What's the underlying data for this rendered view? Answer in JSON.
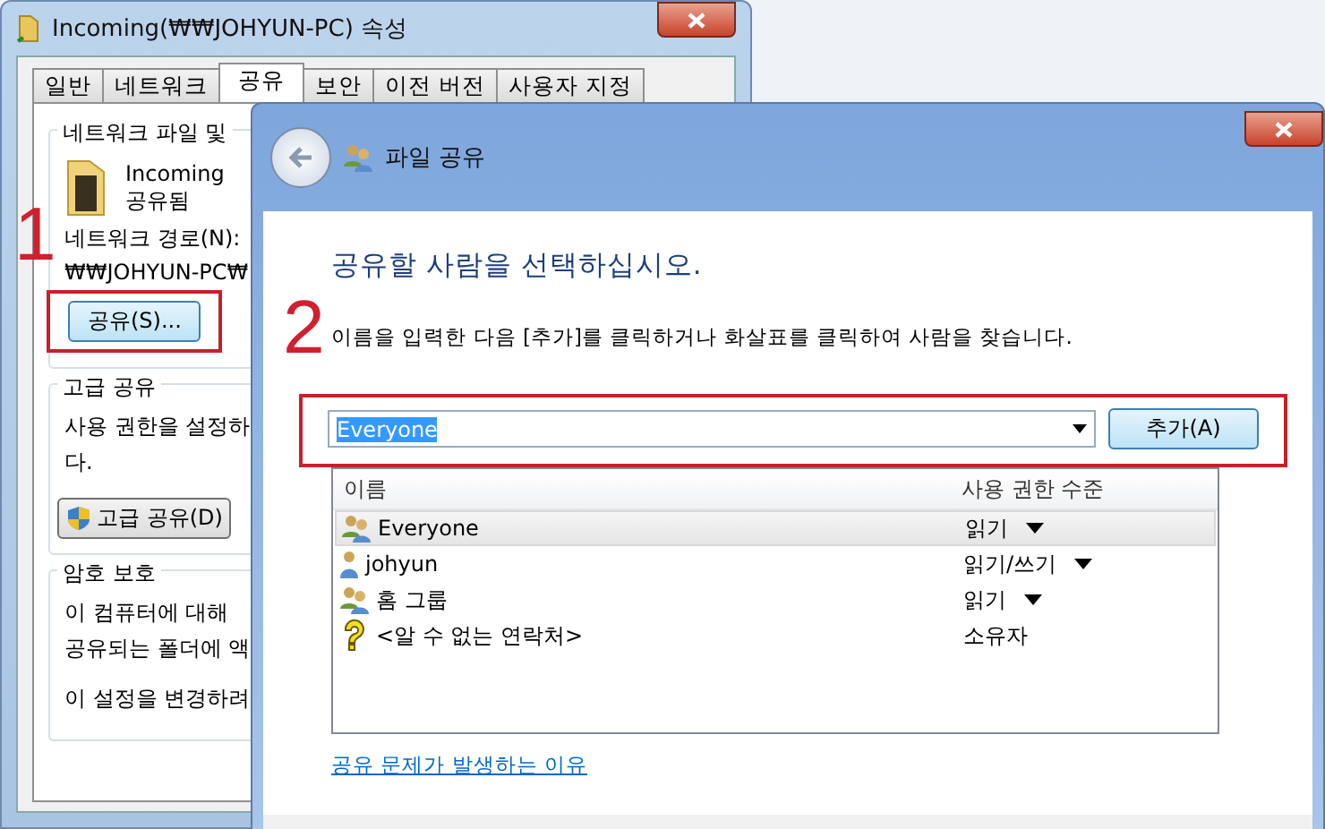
{
  "properties_window": {
    "title": "Incoming(₩₩JOHYUN-PC) 속성",
    "tabs": [
      {
        "label": "일반",
        "selected": false
      },
      {
        "label": "네트워크",
        "selected": false
      },
      {
        "label": "공유",
        "selected": true
      },
      {
        "label": "보안",
        "selected": false
      },
      {
        "label": "이전 버전",
        "selected": false
      },
      {
        "label": "사용자 지정",
        "selected": false
      }
    ],
    "network_sharing": {
      "group_title": "네트워크 파일 및",
      "folder_name": "Incoming",
      "folder_status": "공유됨",
      "path_label": "네트워크 경로(N):",
      "path": "₩₩JOHYUN-PC₩",
      "share_button": "공유(S)..."
    },
    "advanced_sharing": {
      "group_title": "고급 공유",
      "lines": [
        "사용 권한을 설정하",
        "다."
      ],
      "button": "고급 공유(D)"
    },
    "password_protection": {
      "group_title": "암호 보호",
      "lines": [
        "이 컴퓨터에 대해",
        "공유되는 폴더에 액"
      ],
      "note": "이 설정을 변경하려"
    }
  },
  "annotations": [
    "1",
    "2"
  ],
  "file_sharing_dialog": {
    "title": "파일 공유",
    "heading": "공유할 사람을 선택하십시오.",
    "instruction": "이름을 입력한 다음 [추가]를 클릭하거나 화살표를 클릭하여 사람을 찾습니다.",
    "name_field": {
      "value": "Everyone"
    },
    "add_button": "추가(A)",
    "columns": [
      "이름",
      "사용 권한 수준"
    ],
    "rows": [
      {
        "kind": "group",
        "name": "Everyone",
        "permission": "읽기",
        "has_menu": true,
        "selected": true
      },
      {
        "kind": "user",
        "name": "johyun",
        "permission": "읽기/쓰기",
        "has_menu": true,
        "selected": false
      },
      {
        "kind": "group",
        "name": "홈 그룹",
        "permission": "읽기",
        "has_menu": true,
        "selected": false
      },
      {
        "kind": "unknown",
        "name": "<알 수 없는 연락처>",
        "permission": "소유자",
        "has_menu": false,
        "selected": false
      }
    ],
    "link": "공유 문제가 발생하는 이유"
  }
}
